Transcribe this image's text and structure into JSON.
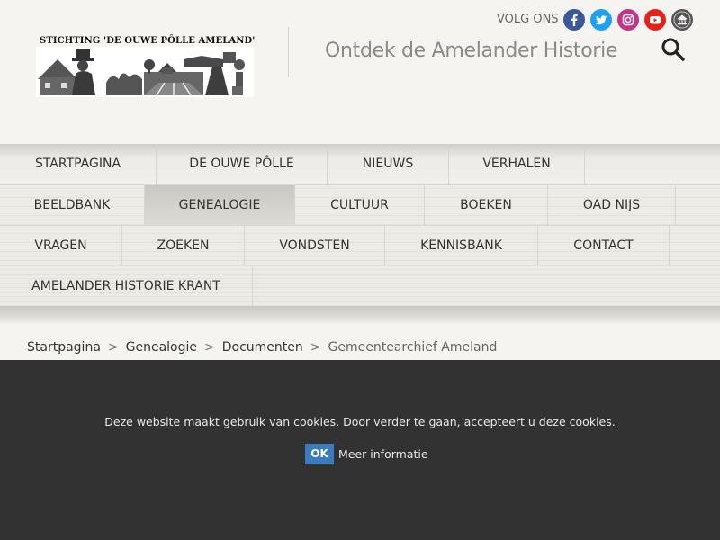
{
  "header": {
    "logo_title": "STICHTING 'DE OUWE PÔLLE AMELAND'",
    "tagline": "Ontdek de Amelander Historie",
    "follow_label": "VOLG ONS",
    "social": [
      {
        "name": "facebook-icon",
        "color": "#3b5998"
      },
      {
        "name": "twitter-icon",
        "color": "#1da1f2"
      },
      {
        "name": "instagram-icon",
        "color": "#c13584"
      },
      {
        "name": "youtube-icon",
        "color": "#e62117"
      },
      {
        "name": "archive-icon",
        "color": "#555555"
      }
    ],
    "search_icon": "search-icon"
  },
  "nav": {
    "rows": [
      [
        "STARTPAGINA",
        "DE OUWE PÔLLE",
        "NIEUWS",
        "VERHALEN"
      ],
      [
        "BEELDBANK",
        "GENEALOGIE",
        "CULTUUR",
        "BOEKEN",
        "OAD NIJS"
      ],
      [
        "VRAGEN",
        "ZOEKEN",
        "VONDSTEN",
        "KENNISBANK",
        "CONTACT"
      ],
      [
        "AMELANDER HISTORIE KRANT"
      ]
    ],
    "active": "GENEALOGIE"
  },
  "breadcrumb": {
    "items": [
      "Startpagina",
      "Genealogie",
      "Documenten"
    ],
    "separator": ">",
    "current": "Gemeentearchief Ameland"
  },
  "cookie": {
    "text": "Deze website maakt gebruik van cookies. Door verder te gaan, accepteert u deze cookies.",
    "ok_label": "OK",
    "more_label": "Meer informatie"
  }
}
